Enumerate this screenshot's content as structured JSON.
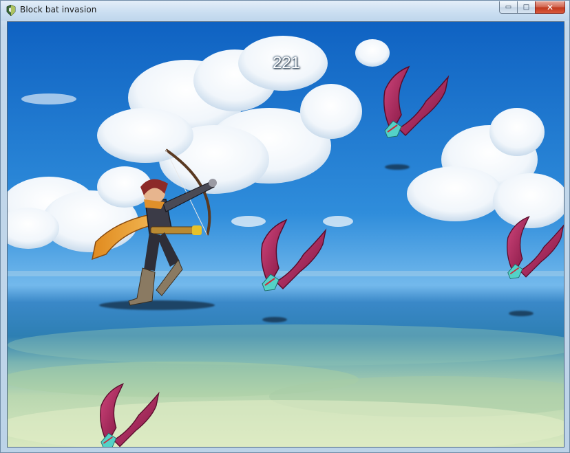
{
  "window": {
    "title": "Block bat invasion",
    "controls": {
      "minimize": "▭",
      "maximize": "□",
      "close": "✕"
    }
  },
  "game": {
    "score": "221",
    "player": {
      "name": "archer",
      "icon": "archer-hero-sprite"
    },
    "enemies": [
      {
        "name": "bat-1",
        "icon": "bat-wing-sprite"
      },
      {
        "name": "bat-2",
        "icon": "bat-wing-sprite"
      },
      {
        "name": "bat-3",
        "icon": "bat-wing-sprite"
      },
      {
        "name": "bat-4",
        "icon": "bat-wing-sprite"
      }
    ],
    "colors": {
      "sky_top": "#1268c6",
      "sky_bottom": "#5aa8e6",
      "sea": "#2c7fb8",
      "sand": "#cfe2b2",
      "bat_wing": "#b32a5e",
      "bat_crest": "#4fd3c8"
    }
  }
}
